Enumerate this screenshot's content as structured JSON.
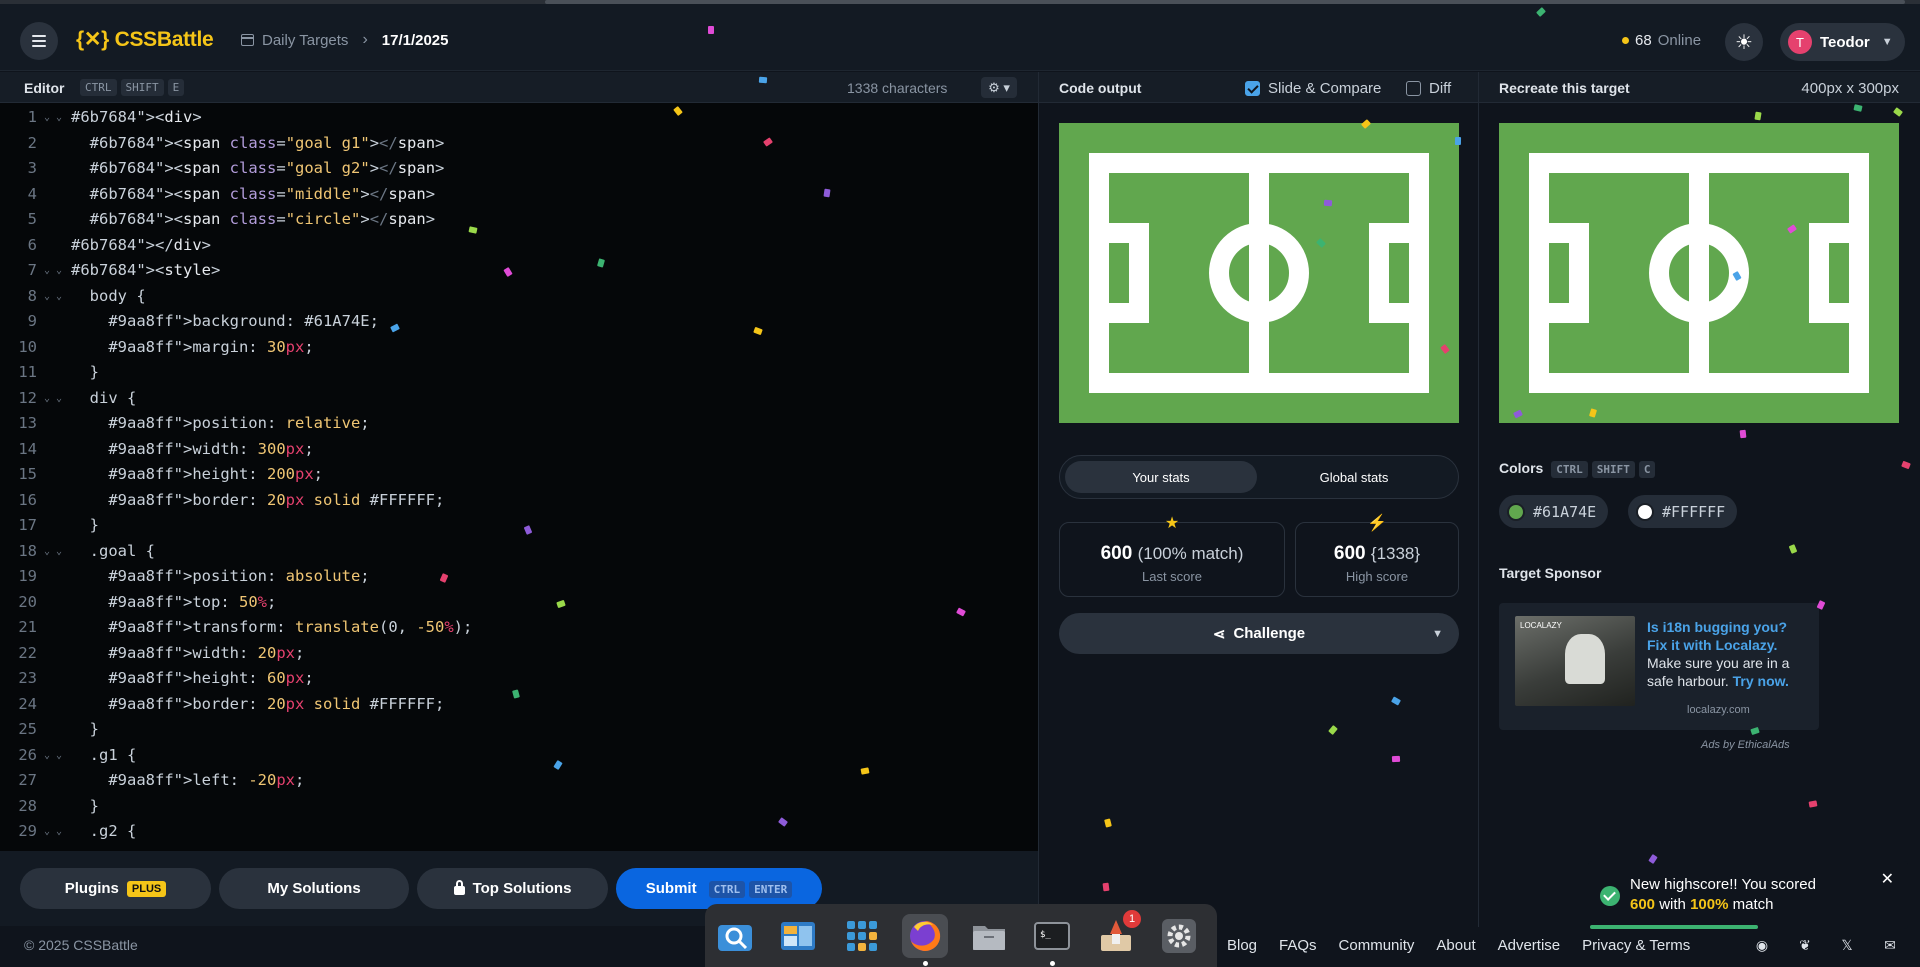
{
  "header": {
    "logo": "{✕} CSSBattle",
    "breadcrumb_parent": "Daily Targets",
    "breadcrumb_current": "17/1/2025",
    "online_count": "68",
    "online_label": "Online",
    "user_initial": "T",
    "user_name": "Teodor"
  },
  "editor": {
    "title": "Editor",
    "shortcut": [
      "CTRL",
      "SHIFT",
      "E"
    ],
    "char_count": "1338 characters",
    "lines": [
      "<div>",
      "  <span class=\"goal g1\"></span>",
      "  <span class=\"goal g2\"></span>",
      "  <span class=\"middle\"></span>",
      "  <span class=\"circle\"></span>",
      "</div>",
      "<style>",
      "  body {",
      "    background: #61A74E;",
      "    margin: 30px;",
      "  }",
      "  div {",
      "    position: relative;",
      "    width: 300px;",
      "    height: 200px;",
      "    border: 20px solid #FFFFFF;",
      "  }",
      "  .goal {",
      "    position: absolute;",
      "    top: 50%;",
      "    transform: translate(0, -50%);",
      "    width: 20px;",
      "    height: 60px;",
      "    border: 20px solid #FFFFFF;",
      "  }",
      "  .g1 {",
      "    left: -20px;",
      "  }",
      "  .g2 {"
    ],
    "fold_lines": [
      1,
      7,
      8,
      12,
      18,
      26,
      29
    ]
  },
  "footer_buttons": {
    "plugins": "Plugins",
    "plus": "PLUS",
    "my_solutions": "My Solutions",
    "top_solutions": "Top Solutions",
    "submit": "Submit",
    "submit_keys": [
      "CTRL",
      "ENTER"
    ]
  },
  "copyright": "© 2025 CSSBattle",
  "output": {
    "title": "Code output",
    "slide_compare": "Slide & Compare",
    "diff": "Diff",
    "tab_your": "Your stats",
    "tab_global": "Global stats",
    "last_score": "600",
    "last_match": "(100% match)",
    "last_label": "Last score",
    "high_score": "600",
    "high_chars": "{1338}",
    "high_label": "High score",
    "challenge": "Challenge"
  },
  "target": {
    "title": "Recreate this target",
    "size": "400px x 300px",
    "colors_title": "Colors",
    "colors_keys": [
      "CTRL",
      "SHIFT",
      "C"
    ],
    "colors": [
      "#61A74E",
      "#FFFFFF"
    ],
    "sponsor_title": "Target Sponsor",
    "ad_headline": "Is i18n bugging you? Fix it with Localazy.",
    "ad_body": "Make sure you are in a safe harbour.",
    "ad_cta": "Try now.",
    "ad_domain": "localazy.com",
    "ad_image_text": "LOCALAZY",
    "ads_by": "Ads by EthicalAds"
  },
  "toast": {
    "line1": "New highscore!! You scored",
    "score": "600",
    "with": "with",
    "match": "100%",
    "match_suffix": "match"
  },
  "footer_links": [
    "Blog",
    "FAQs",
    "Community",
    "About",
    "Advertise",
    "Privacy & Terms"
  ],
  "dock": {
    "items": [
      "search-app",
      "files-preview-app",
      "app-grid",
      "firefox",
      "file-manager",
      "terminal",
      "launcher",
      "settings"
    ],
    "launcher_badge": "1"
  },
  "field_colors": {
    "background": "#61A74E",
    "lines": "#FFFFFF"
  }
}
